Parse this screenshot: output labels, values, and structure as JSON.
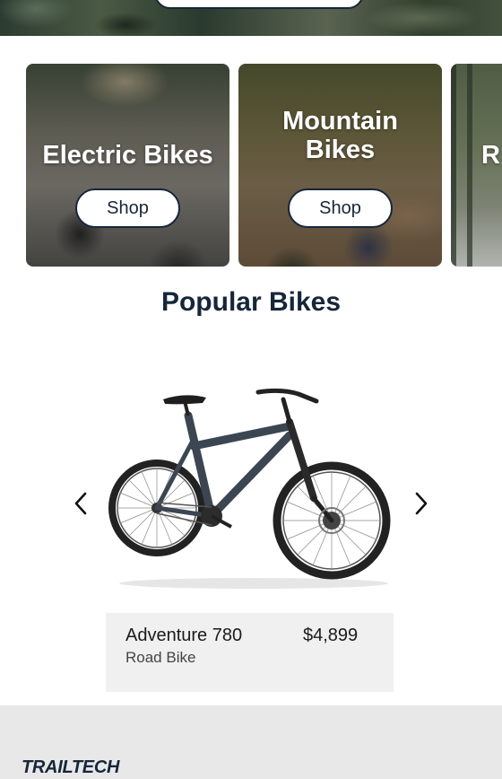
{
  "categories": [
    {
      "title": "Electric Bikes",
      "button": "Shop"
    },
    {
      "title_line1": "Mountain",
      "title_line2": "Bikes",
      "button": "Shop"
    },
    {
      "title_partial": "R"
    }
  ],
  "popular": {
    "heading": "Popular Bikes",
    "product": {
      "name": "Adventure 780",
      "type": "Road Bike",
      "price": "$4,899"
    }
  },
  "footer": {
    "logo": "TRAILTECH"
  },
  "colors": {
    "navy": "#16263a",
    "card_bg": "#f0f0f0",
    "footer_bg": "#e8e8e8"
  }
}
